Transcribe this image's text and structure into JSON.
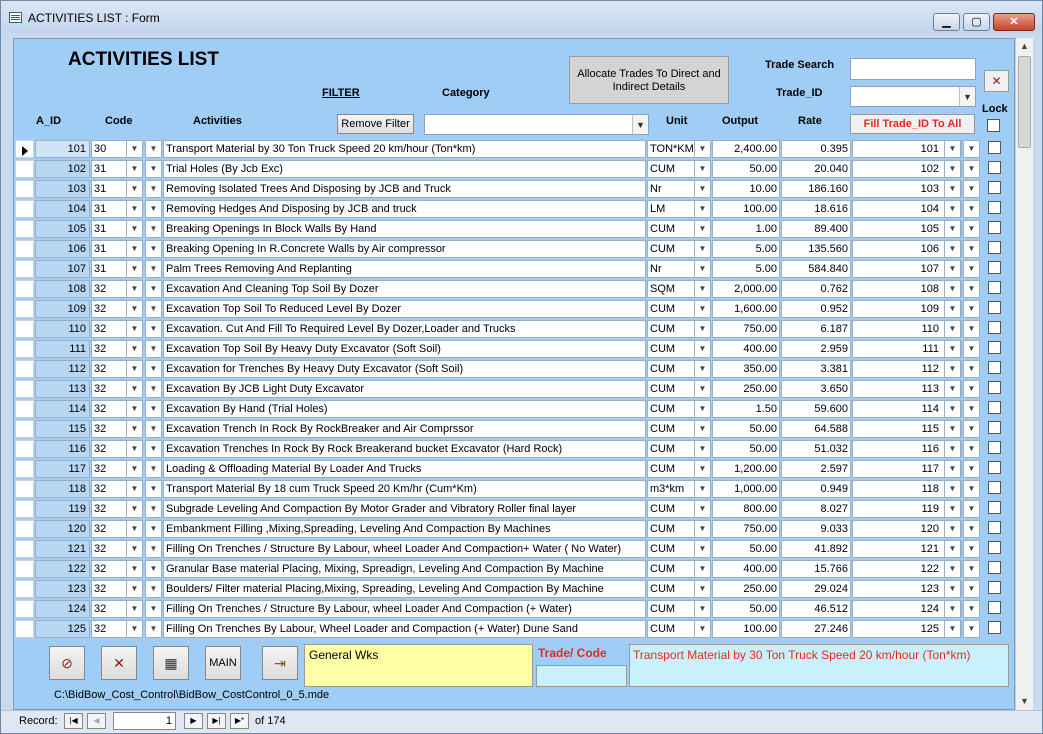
{
  "window": {
    "title": "ACTIVITIES LIST : Form"
  },
  "form": {
    "heading": "ACTIVITIES LIST",
    "filter_label": "FILTER",
    "category_label": "Category",
    "remove_filter_label": "Remove Filter",
    "allocate_label": "Allocate Trades To Direct and Indirect Details",
    "trade_search_label": "Trade Search",
    "trade_id_label": "Trade_ID",
    "fill_trade_label": "Fill Trade_ID To All",
    "lock_label": "Lock",
    "columns": {
      "a_id": "A_ID",
      "code": "Code",
      "activities": "Activities",
      "unit": "Unit",
      "output": "Output",
      "rate": "Rate"
    }
  },
  "rows": [
    {
      "id": "101",
      "code": "30",
      "activity": "Transport Material by 30 Ton Truck Speed 20 km/hour (Ton*km)",
      "unit": "TON*KM",
      "output": "2,400.00",
      "rate": "0.395",
      "trade": "101"
    },
    {
      "id": "102",
      "code": "31",
      "activity": "Trial Holes (By Jcb Exc)",
      "unit": "CUM",
      "output": "50.00",
      "rate": "20.040",
      "trade": "102"
    },
    {
      "id": "103",
      "code": "31",
      "activity": "Removing Isolated Trees And Disposing by JCB and Truck",
      "unit": "Nr",
      "output": "10.00",
      "rate": "186.160",
      "trade": "103"
    },
    {
      "id": "104",
      "code": "31",
      "activity": "Removing Hedges And Disposing by JCB and truck",
      "unit": "LM",
      "output": "100.00",
      "rate": "18.616",
      "trade": "104"
    },
    {
      "id": "105",
      "code": "31",
      "activity": "Breaking Openings In Block Walls By Hand",
      "unit": "CUM",
      "output": "1.00",
      "rate": "89.400",
      "trade": "105"
    },
    {
      "id": "106",
      "code": "31",
      "activity": "Breaking Opening In R.Concrete Walls by Air compressor",
      "unit": "CUM",
      "output": "5.00",
      "rate": "135.560",
      "trade": "106"
    },
    {
      "id": "107",
      "code": "31",
      "activity": "Palm Trees Removing And Replanting",
      "unit": "Nr",
      "output": "5.00",
      "rate": "584.840",
      "trade": "107"
    },
    {
      "id": "108",
      "code": "32",
      "activity": "Excavation And Cleaning Top Soil By Dozer",
      "unit": "SQM",
      "output": "2,000.00",
      "rate": "0.762",
      "trade": "108"
    },
    {
      "id": "109",
      "code": "32",
      "activity": "Excavation Top Soil  To Reduced Level By Dozer",
      "unit": "CUM",
      "output": "1,600.00",
      "rate": "0.952",
      "trade": "109"
    },
    {
      "id": "110",
      "code": "32",
      "activity": "Excavation. Cut And Fill To Required  Level  By Dozer,Loader and Trucks",
      "unit": "CUM",
      "output": "750.00",
      "rate": "6.187",
      "trade": "110"
    },
    {
      "id": "111",
      "code": "32",
      "activity": "Excavation Top Soil  By Heavy Duty Excavator (Soft Soil)",
      "unit": "CUM",
      "output": "400.00",
      "rate": "2.959",
      "trade": "111"
    },
    {
      "id": "112",
      "code": "32",
      "activity": "Excavation for Trenches By Heavy Duty Excavator (Soft Soil)",
      "unit": "CUM",
      "output": "350.00",
      "rate": "3.381",
      "trade": "112"
    },
    {
      "id": "113",
      "code": "32",
      "activity": "Excavation By JCB  Light Duty Excavator",
      "unit": "CUM",
      "output": "250.00",
      "rate": "3.650",
      "trade": "113"
    },
    {
      "id": "114",
      "code": "32",
      "activity": "Excavation By Hand (Trial Holes)",
      "unit": "CUM",
      "output": "1.50",
      "rate": "59.600",
      "trade": "114"
    },
    {
      "id": "115",
      "code": "32",
      "activity": "Excavation Trench In Rock By RockBreaker and Air Comprssor",
      "unit": "CUM",
      "output": "50.00",
      "rate": "64.588",
      "trade": "115"
    },
    {
      "id": "116",
      "code": "32",
      "activity": "Excavation Trenches In Rock By Rock Breakerand bucket Excavator (Hard Rock)",
      "unit": "CUM",
      "output": "50.00",
      "rate": "51.032",
      "trade": "116"
    },
    {
      "id": "117",
      "code": "32",
      "activity": "Loading & Offloading Material By Loader And Trucks",
      "unit": "CUM",
      "output": "1,200.00",
      "rate": "2.597",
      "trade": "117"
    },
    {
      "id": "118",
      "code": "32",
      "activity": "Transport Material By 18 cum Truck Speed 20 Km/hr (Cum*Km)",
      "unit": "m3*km",
      "output": "1,000.00",
      "rate": "0.949",
      "trade": "118"
    },
    {
      "id": "119",
      "code": "32",
      "activity": "Subgrade Leveling And Compaction By Motor Grader and Vibratory Roller final layer",
      "unit": "CUM",
      "output": "800.00",
      "rate": "8.027",
      "trade": "119"
    },
    {
      "id": "120",
      "code": "32",
      "activity": "Embankment Filling ,Mixing,Spreading, Leveling And Compaction By Machines",
      "unit": "CUM",
      "output": "750.00",
      "rate": "9.033",
      "trade": "120"
    },
    {
      "id": "121",
      "code": "32",
      "activity": "Filling On Trenches / Structure By Labour, wheel Loader And Compaction+ Water ( No Water)",
      "unit": "CUM",
      "output": "50.00",
      "rate": "41.892",
      "trade": "121"
    },
    {
      "id": "122",
      "code": "32",
      "activity": "Granular Base material Placing, Mixing, Spreadign, Leveling And Compaction By Machine",
      "unit": "CUM",
      "output": "400.00",
      "rate": "15.766",
      "trade": "122"
    },
    {
      "id": "123",
      "code": "32",
      "activity": "Boulders/ Filter material Placing,Mixing, Spreading, Leveling And Compaction By Machine",
      "unit": "CUM",
      "output": "250.00",
      "rate": "29.024",
      "trade": "123"
    },
    {
      "id": "124",
      "code": "32",
      "activity": "Filling On Trenches / Structure By Labour, wheel Loader And Compaction (+ Water)",
      "unit": "CUM",
      "output": "50.00",
      "rate": "46.512",
      "trade": "124"
    },
    {
      "id": "125",
      "code": "32",
      "activity": "Filling On Trenches By Labour, Wheel Loader and Compaction (+ Water) Dune Sand",
      "unit": "CUM",
      "output": "100.00",
      "rate": "27.246",
      "trade": "125"
    }
  ],
  "footer": {
    "main_label": "MAIN",
    "general_text": "General Wks",
    "trade_code_label": "Trade/ Code",
    "description_text": "Transport Material by 30 Ton Truck Speed 20 km/hour (Ton*km)",
    "path": "C:\\BidBow_Cost_Control\\BidBow_CostControl_0_5.mde"
  },
  "record_nav": {
    "label": "Record:",
    "current": "1",
    "of_label": "of",
    "total": "174"
  }
}
